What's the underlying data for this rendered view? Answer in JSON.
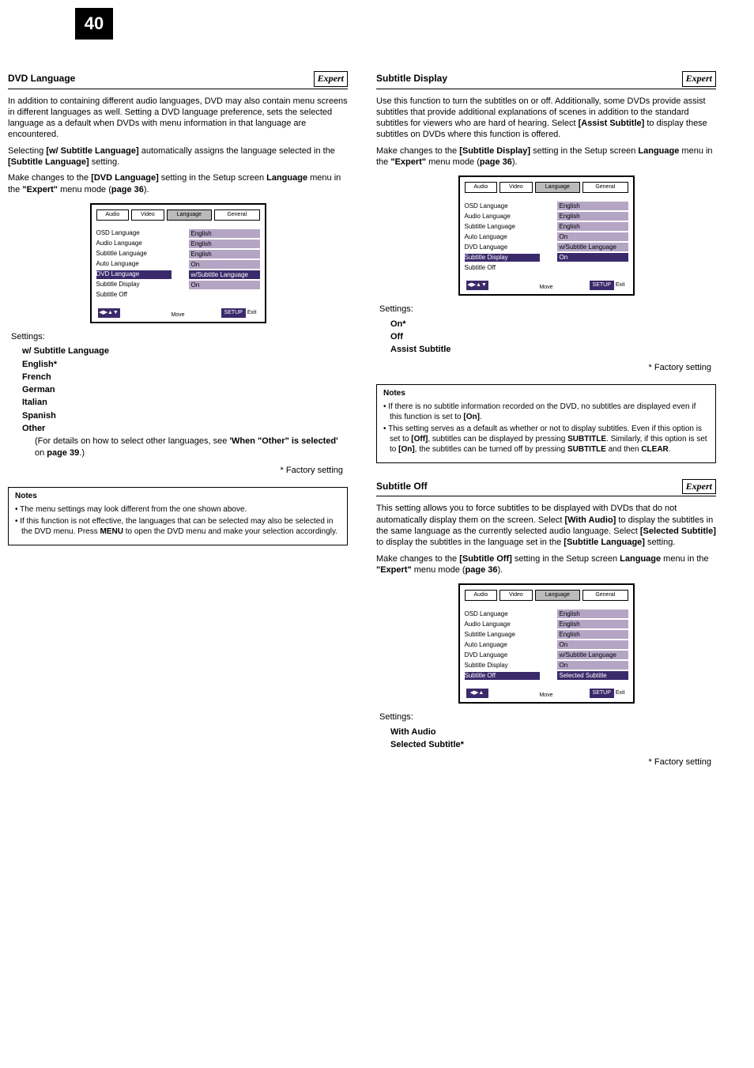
{
  "page_number": "40",
  "left": {
    "header_title": "DVD Language",
    "expert": "Expert",
    "para": "In addition to containing different audio languages, DVD may also contain menu screens in different languages as well. Setting a DVD language preference, sets the selected language as a default when DVDs with menu information in that language are encountered.",
    "line1a": "Selecting ",
    "line1b": "[w/ Subtitle Language]",
    "line1c": " automatically assigns the language selected in the ",
    "line1d": "[Subtitle Language]",
    "line1e": " setting.",
    "line2a": "Make changes to the ",
    "line2b": "[DVD Language]",
    "line2c": " setting in the Setup screen ",
    "line2d": "Language",
    "line2e": " menu in the ",
    "line2f": "\"Expert\"",
    "line2g": " menu mode (",
    "line2h": "page 36",
    "line2i": ").",
    "settings_label": "Settings:",
    "set1": "w/ Subtitle Language",
    "set2": "English*",
    "set3": "French",
    "set4": "German",
    "set5": "Italian",
    "set6": "Spanish",
    "set7": "Other",
    "other_a": "(For details on how to select other languages, see ",
    "other_b": "'When \"Other\" is selected'",
    "other_c": " on ",
    "other_d": "page 39",
    "other_e": ".)",
    "factory": "* Factory setting",
    "note_title": "Notes",
    "note1": "The menu settings may look different from the one shown above.",
    "note2a": "If this function is not effective, the languages that can be selected may also be selected in the DVD menu. Press ",
    "note2b": "MENU",
    "note2c": " to open the DVD menu and make your selection accordingly.",
    "scr": {
      "tab1": "Audio",
      "tab2": "Video",
      "tab3": "Language",
      "tab4": "General",
      "r1l": "OSD Language",
      "r1v": "English",
      "r2l": "Audio Language",
      "r2v": "English",
      "r3l": "Subtitle Language",
      "r3v": "English",
      "r4l": "Auto Language",
      "r4v": "On",
      "r5l": "DVD Language",
      "r5v": "w/Subtitle Language",
      "r6l": "Subtitle Display",
      "r6v": "On",
      "r7l": "Subtitle Off",
      "arrows": "◀▶▲▼",
      "move": "Move",
      "setupLabel": "Exit",
      "setup": "SETUP"
    }
  },
  "right": {
    "sub_display": {
      "header_title": "Subtitle Display",
      "expert": "Expert",
      "para1a": "Use this function to turn the subtitles on or off. Additionally, some DVDs provide assist subtitles that provide additional explanations of scenes in addition to the standard subtitles for viewers who are hard of hearing. Select ",
      "para1b": "[Assist Subtitle]",
      "para1c": " to display these subtitles on DVDs where this function is offered.",
      "line2a": "Make changes to the ",
      "line2b": "[Subtitle Display]",
      "line2c": " setting in the Setup screen ",
      "line2d": "Language",
      "line2e": " menu in the ",
      "line2f": "\"Expert\"",
      "line2g": " menu mode (",
      "line2h": "page 36",
      "line2i": ").",
      "settings_label": "Settings:",
      "set1": "On*",
      "set2": "Off",
      "set3": "Assist Subtitle",
      "factory": "* Factory setting",
      "note_title": "Notes",
      "note1a": "If there is no subtitle information recorded on the DVD, no subtitles are displayed even if this function is set to ",
      "note1b": "[On]",
      "note1c": ".",
      "note2a": "This setting serves as a default as whether or not to display subtitles. Even if this option is set to ",
      "note2b": "[Off]",
      "note2c": ", subtitles can be displayed by pressing ",
      "note2d": "SUBTITLE",
      "note2e": ". Similarly, if this option is set to ",
      "note2f": "[On]",
      "note2g": ", the subtitles can be turned off by pressing ",
      "note2h": "SUBTITLE",
      "note2i": " and then ",
      "note2j": "CLEAR",
      "note2k": ".",
      "scr": {
        "tab1": "Audio",
        "tab2": "Video",
        "tab3": "Language",
        "tab4": "General",
        "r1l": "OSD Language",
        "r1v": "English",
        "r2l": "Audio Language",
        "r2v": "English",
        "r3l": "Subtitle Language",
        "r3v": "English",
        "r4l": "Auto Language",
        "r4v": "On",
        "r5l": "DVD Language",
        "r5v": "w/Subtitle Language",
        "r6l": "Subtitle Display",
        "r6v": "On",
        "r7l": "Subtitle Off",
        "arrows": "◀▶▲▼",
        "move": "Move",
        "setupLabel": "Exit",
        "setup": "SETUP"
      }
    },
    "sub_off": {
      "header_title": "Subtitle Off",
      "expert": "Expert",
      "para1a": "This setting allows you to force subtitles to be displayed with DVDs that do not automatically display them on the screen. Select ",
      "para1b": "[With Audio]",
      "para1c": " to display the subtitles in the same language as the currently selected audio language. Select ",
      "para1d": "[Selected Subtitle]",
      "para1e": " to display the subtitles in the language set in the ",
      "para1f": "[Subtitle Language]",
      "para1g": " setting.",
      "line2a": "Make changes to the ",
      "line2b": "[Subtitle Off]",
      "line2c": " setting in the Setup screen ",
      "line2d": "Language",
      "line2e": " menu in the ",
      "line2f": "\"Expert\"",
      "line2g": " menu mode (",
      "line2h": "page 36",
      "line2i": ").",
      "settings_label": "Settings:",
      "set1": "With Audio",
      "set2": "Selected Subtitle*",
      "factory": "* Factory setting",
      "scr": {
        "tab1": "Audio",
        "tab2": "Video",
        "tab3": "Language",
        "tab4": "General",
        "r1l": "OSD Language",
        "r1v": "English",
        "r2l": "Audio Language",
        "r2v": "English",
        "r3l": "Subtitle Language",
        "r3v": "English",
        "r4l": "Auto Language",
        "r4v": "On",
        "r5l": "DVD Language",
        "r5v": "w/Subtitle Language",
        "r6l": "Subtitle Display",
        "r6v": "On",
        "r7l": "Subtitle Off",
        "r7v": "Selected Subtitle",
        "arrows": "◀▶▲",
        "move": "Move",
        "setupLabel": "Exit",
        "setup": "SETUP"
      }
    }
  }
}
